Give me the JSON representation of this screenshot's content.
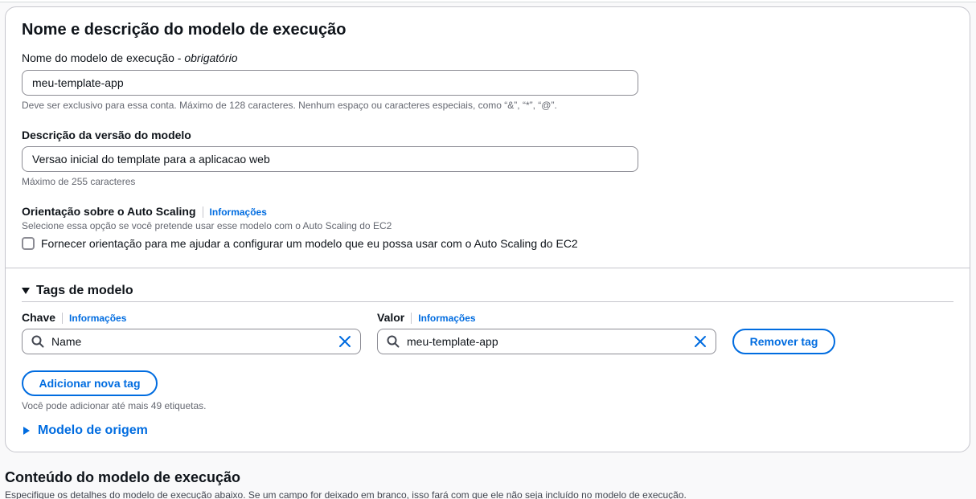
{
  "name_section": {
    "title": "Nome e descrição do modelo de execução",
    "name_label": "Nome do modelo de execução",
    "name_label_sep": " - ",
    "name_required": "obrigatório",
    "name_value": "meu-template-app",
    "name_hint": "Deve ser exclusivo para essa conta. Máximo de 128 caracteres. Nenhum espaço ou caracteres especiais, como “&”, “*”, “@”.",
    "desc_label": "Descrição da versão do modelo",
    "desc_value": "Versao inicial do template para a aplicacao web",
    "desc_hint": "Máximo de 255 caracteres",
    "asg_label": "Orientação sobre o Auto Scaling",
    "asg_info": "Informações",
    "asg_hint": "Selecione essa opção se você pretende usar esse modelo com o Auto Scaling do EC2",
    "asg_checkbox_label": "Fornecer orientação para me ajudar a configurar um modelo que eu possa usar com o Auto Scaling do EC2",
    "asg_checked": false
  },
  "tags": {
    "title": "Tags de modelo",
    "key_label": "Chave",
    "key_info": "Informações",
    "value_label": "Valor",
    "value_info": "Informações",
    "key_value": "Name",
    "value_value": "meu-template-app",
    "remove_button": "Remover tag",
    "add_button": "Adicionar nova tag",
    "add_hint": "Você pode adicionar até mais 49 etiquetas."
  },
  "source_template": {
    "label": "Modelo de origem"
  },
  "content_section": {
    "title": "Conteúdo do modelo de execução",
    "description": "Especifique os detalhes do modelo de execução abaixo. Se um campo for deixado em branco, isso fará com que ele não seja incluído no modelo de execução."
  },
  "colors": {
    "link": "#006ce0",
    "text": "#0f141a",
    "muted": "#656871",
    "border": "#8c8c94"
  },
  "icons": [
    "search-icon",
    "clear-icon",
    "caret-down-icon",
    "caret-right-icon",
    "checkbox-icon"
  ]
}
